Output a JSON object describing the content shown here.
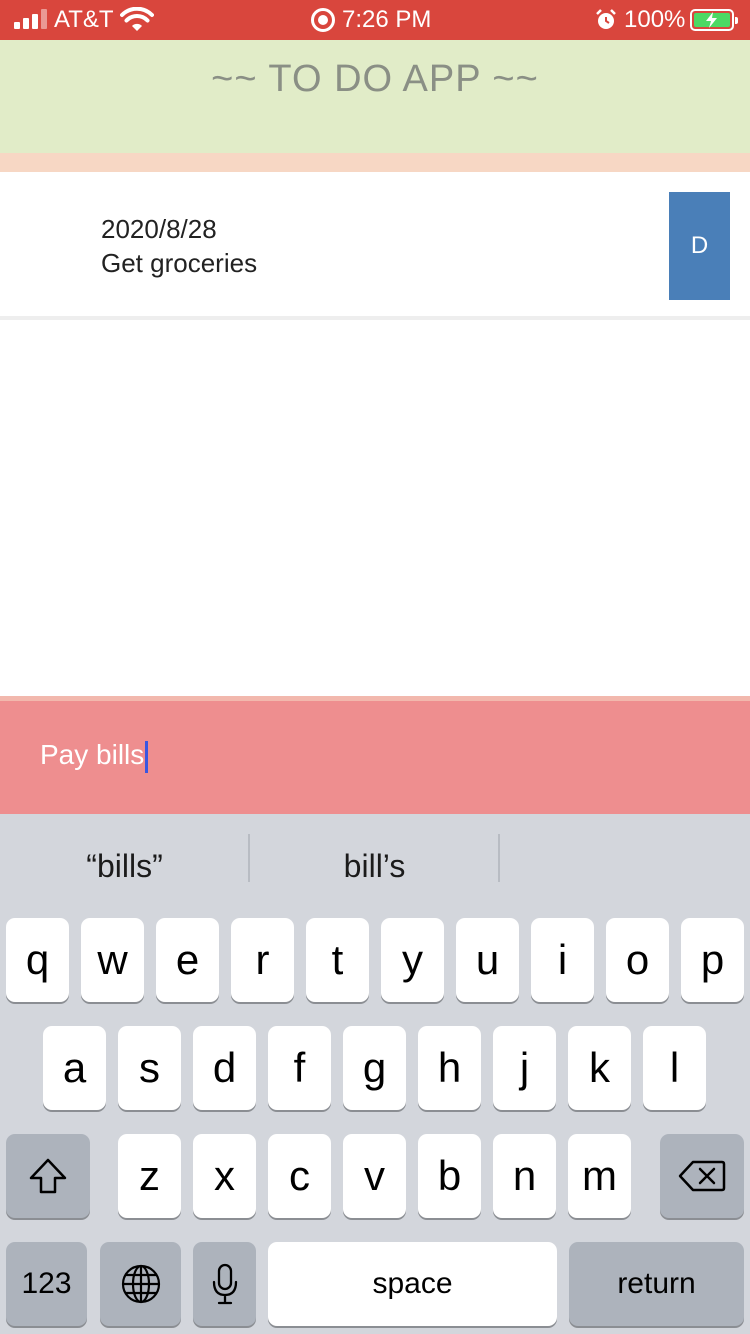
{
  "status_bar": {
    "carrier": "AT&T",
    "time": "7:26 PM",
    "battery_percent": "100%"
  },
  "header": {
    "title": "~~ TO DO APP ~~"
  },
  "todos": [
    {
      "date": "2020/8/28",
      "text": "Get groceries",
      "delete_label": "D"
    }
  ],
  "input": {
    "value": "Pay bills"
  },
  "keyboard": {
    "suggestions": [
      "“bills”",
      "bill’s"
    ],
    "row1": [
      "q",
      "w",
      "e",
      "r",
      "t",
      "y",
      "u",
      "i",
      "o",
      "p"
    ],
    "row2": [
      "a",
      "s",
      "d",
      "f",
      "g",
      "h",
      "j",
      "k",
      "l"
    ],
    "row3": [
      "z",
      "x",
      "c",
      "v",
      "b",
      "n",
      "m"
    ],
    "numbers_label": "123",
    "space_label": "space",
    "return_label": "return"
  },
  "colors": {
    "status_bar": "#d9463d",
    "header_bg": "#e1ecc8",
    "input_bar": "#ee8e8f",
    "delete_button": "#4a7fb8"
  }
}
